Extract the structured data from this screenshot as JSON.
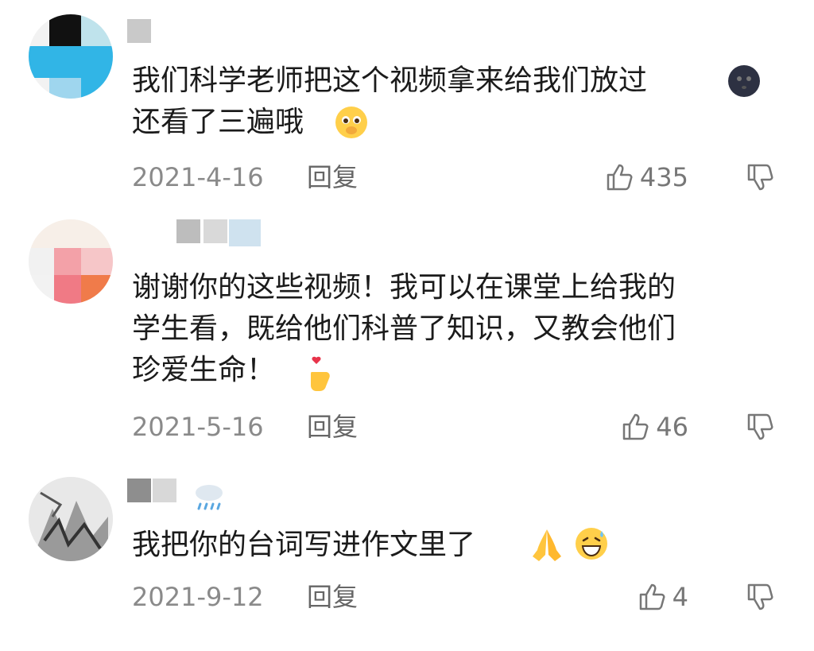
{
  "comments": [
    {
      "text": "我们科学老师把这个视频拿来给我们放过\n还看了三遍哦",
      "emoji_icons": [
        "new-moon-face-icon",
        "pleading-face-icon"
      ],
      "date": "2021-4-16",
      "reply_label": "回复",
      "likes": "435"
    },
    {
      "text": "谢谢你的这些视频！我可以在课堂上给我的\n学生看，既给他们科普了知识，又教会他们\n珍爱生命！",
      "emoji_icons": [
        "finger-heart-icon"
      ],
      "date": "2021-5-16",
      "reply_label": "回复",
      "likes": "46"
    },
    {
      "text": "我把你的台词写进作文里了",
      "emoji_icons": [
        "folded-hands-icon",
        "grinning-sweat-icon"
      ],
      "date": "2021-9-12",
      "reply_label": "回复",
      "likes": "4"
    }
  ],
  "colors": {
    "text": "#1b1b1b",
    "meta": "#8a8a8a",
    "icon_stroke": "#777777"
  }
}
